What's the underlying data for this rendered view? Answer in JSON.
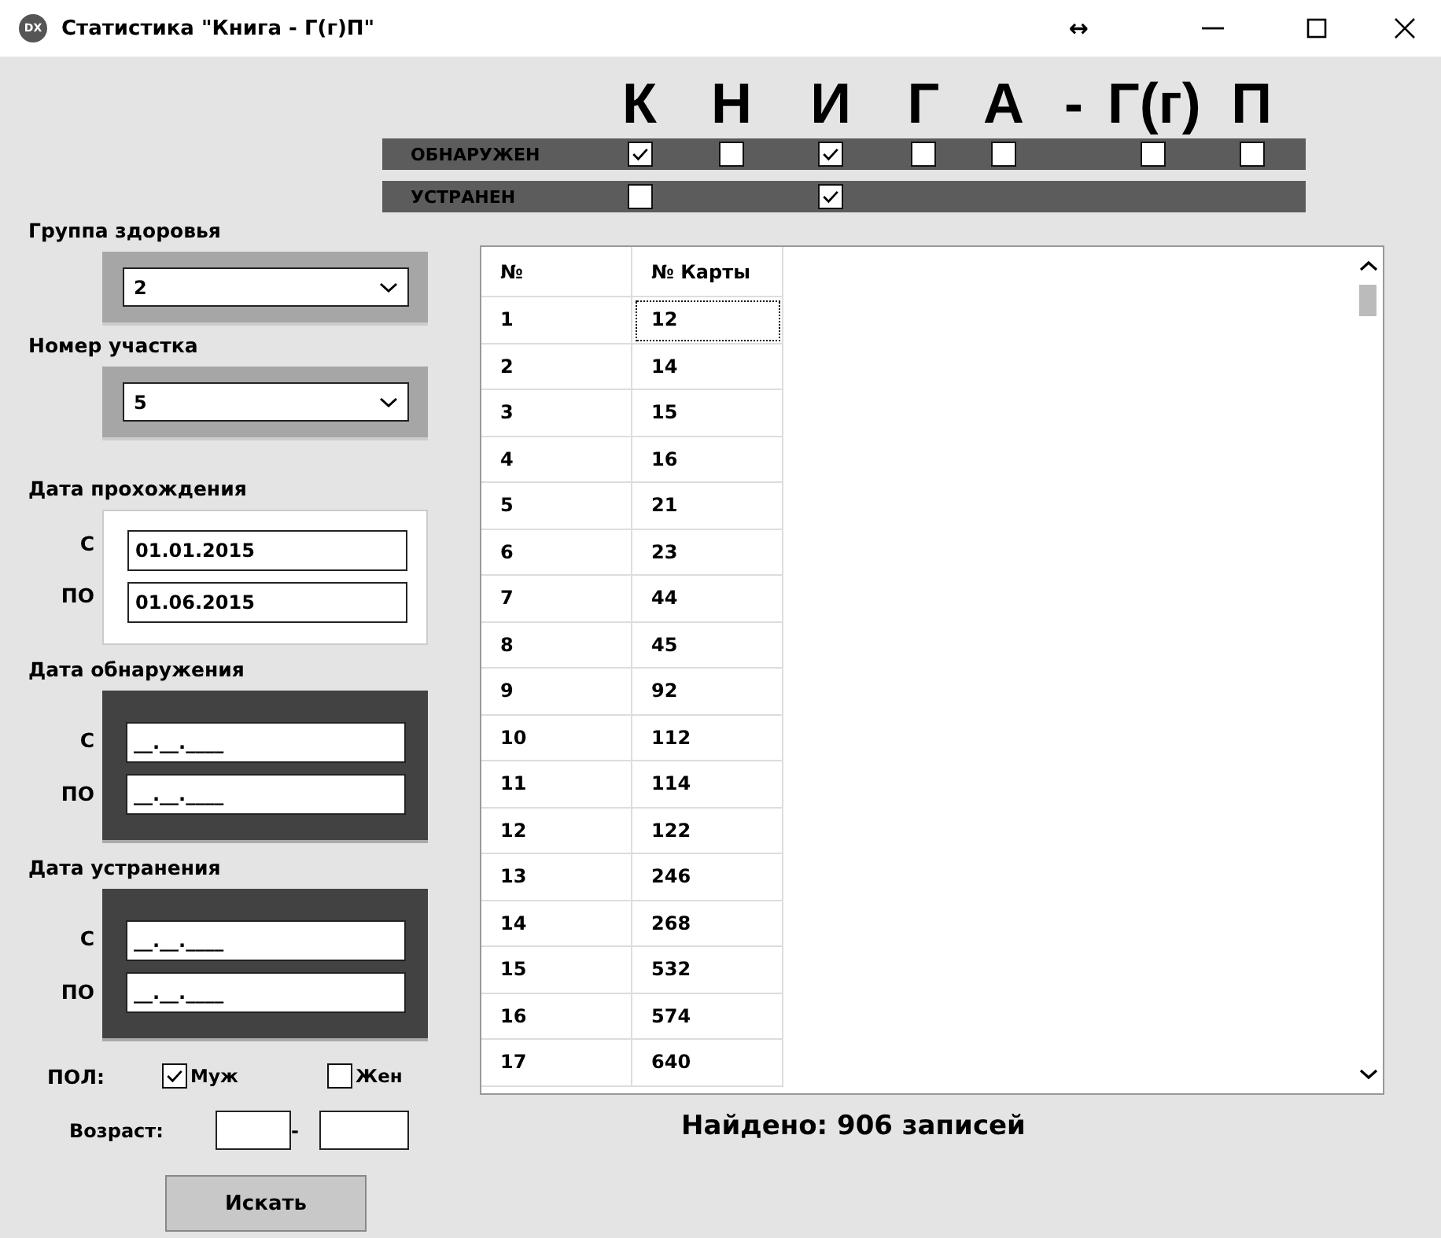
{
  "window": {
    "title": "Статистика \"Книга - Г(г)П\"",
    "badge": "DX",
    "resize_glyph": "↔"
  },
  "header": {
    "letters": [
      {
        "text": "К",
        "detected": true,
        "fixed": false
      },
      {
        "text": "Н",
        "detected": false
      },
      {
        "text": "И",
        "detected": true,
        "fixed": true
      },
      {
        "text": "Г",
        "detected": false
      },
      {
        "text": "А",
        "detected": false
      },
      {
        "text": "-"
      },
      {
        "text": "Г(г)",
        "detected": false
      },
      {
        "text": "П",
        "detected": false
      }
    ],
    "status_rows": [
      {
        "label": "ОБНАРУЖЕН",
        "kind": "detected"
      },
      {
        "label": "УСТРАНЕН",
        "kind": "fixed"
      }
    ]
  },
  "filters": {
    "health_group": {
      "label": "Группа здоровья",
      "value": "2"
    },
    "district": {
      "label": "Номер участка",
      "value": "5"
    },
    "date_ranges": [
      {
        "label": "Дата прохождения",
        "kind": "light",
        "from_label": "С",
        "from": "01.01.2015",
        "to_label": "ПО",
        "to": "01.06.2015"
      },
      {
        "label": "Дата обнаружения",
        "kind": "dark",
        "from_label": "С",
        "from_placeholder": "__.__.____",
        "to_label": "ПО",
        "to_placeholder": "__.__.____"
      },
      {
        "label": "Дата устранения",
        "kind": "dark",
        "from_label": "С",
        "from_placeholder": "__.__.____",
        "to_label": "ПО",
        "to_placeholder": "__.__.____"
      }
    ],
    "gender": {
      "label": "ПОЛ:",
      "options": [
        {
          "label": "Муж",
          "checked": true
        },
        {
          "label": "Жен",
          "checked": false
        }
      ]
    },
    "age": {
      "label": "Возраст:",
      "separator": "-"
    },
    "search_button": "Искать"
  },
  "table": {
    "columns": [
      "№",
      "№ Карты"
    ],
    "rows": [
      {
        "number": "1",
        "card": "12",
        "focused": true
      },
      {
        "number": "2",
        "card": "14",
        "focused": false
      },
      {
        "number": "3",
        "card": "15",
        "focused": false
      },
      {
        "number": "4",
        "card": "16",
        "focused": false
      },
      {
        "number": "5",
        "card": "21",
        "focused": false
      },
      {
        "number": "6",
        "card": "23",
        "focused": false
      },
      {
        "number": "7",
        "card": "44",
        "focused": false
      },
      {
        "number": "8",
        "card": "45",
        "focused": false
      },
      {
        "number": "9",
        "card": "92",
        "focused": false
      },
      {
        "number": "10",
        "card": "112",
        "focused": false
      },
      {
        "number": "11",
        "card": "114",
        "focused": false
      },
      {
        "number": "12",
        "card": "122",
        "focused": false
      },
      {
        "number": "13",
        "card": "246",
        "focused": false
      },
      {
        "number": "14",
        "card": "268",
        "focused": false
      },
      {
        "number": "15",
        "card": "532",
        "focused": false
      },
      {
        "number": "16",
        "card": "574",
        "focused": false
      },
      {
        "number": "17",
        "card": "640",
        "focused": false
      }
    ]
  },
  "result": "Найдено: 906 записей"
}
